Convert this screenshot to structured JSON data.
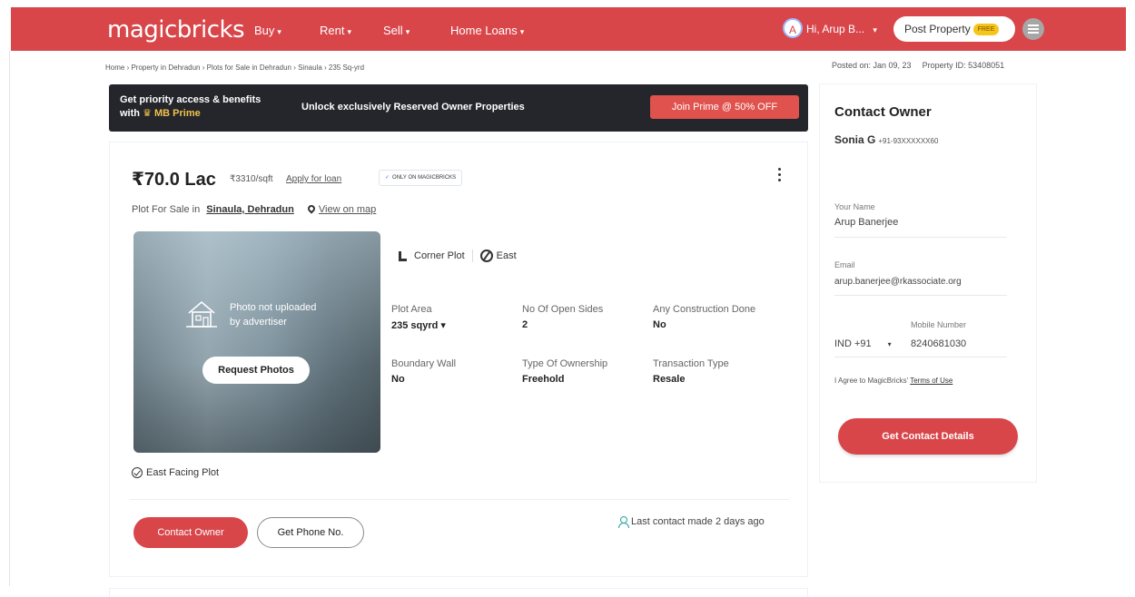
{
  "header": {
    "logo": "magicbricks",
    "nav": [
      {
        "label": "Buy"
      },
      {
        "label": "Rent"
      },
      {
        "label": "Sell"
      },
      {
        "label": "Home Loans"
      }
    ],
    "avatar_letter": "A",
    "greeting": "Hi, Arup B...",
    "post_property": "Post Property",
    "free_badge": "FREE",
    "brand_color": "#d8464a"
  },
  "breadcrumb": "Home › Property in Dehradun › Plots for Sale in Dehradun › Sinaula › 235 Sq-yrd",
  "meta": {
    "posted_on": "Posted on: Jan 09, 23",
    "property_id": "Property ID: 53408051"
  },
  "prime": {
    "line1": "Get priority access & benefits",
    "line2_prefix": "with",
    "line2_brand": "MB Prime",
    "middle": "Unlock exclusively Reserved Owner Properties",
    "button": "Join Prime @ 50% OFF"
  },
  "listing": {
    "price": "₹70.0 Lac",
    "price_per_sqft": "₹3310/sqft",
    "apply_loan": "Apply for loan",
    "only_badge": "ONLY ON MAGICBRICKS",
    "plot_for_sale": "Plot For Sale in",
    "locality": "Sinaula, Dehradun",
    "view_map": "View on map",
    "photo_text_1": "Photo not uploaded",
    "photo_text_2": "by advertiser",
    "request_photos": "Request Photos",
    "chip_corner": "Corner Plot",
    "chip_facing": "East",
    "specs": [
      {
        "label": "Plot Area",
        "value": "235 sqyrd ▾"
      },
      {
        "label": "No Of Open Sides",
        "value": "2"
      },
      {
        "label": "Any Construction Done",
        "value": "No"
      },
      {
        "label": "Boundary Wall",
        "value": "No"
      },
      {
        "label": "Type Of Ownership",
        "value": "Freehold"
      },
      {
        "label": "Transaction Type",
        "value": "Resale"
      }
    ],
    "highlight": "East Facing Plot",
    "contact_owner": "Contact Owner",
    "get_phone": "Get Phone No.",
    "last_contact": "Last contact made 2 days ago"
  },
  "owner_panel": {
    "title": "Contact Owner",
    "owner_name": "Sonia G",
    "owner_phone": "+91-93XXXXXX60",
    "name_label": "Your Name",
    "name_value": "Arup Banerjee",
    "email_label": "Email",
    "email_value": "arup.banerjee@rkassociate.org",
    "mobile_label": "Mobile Number",
    "country_code": "IND +91",
    "mobile_value": "8240681030",
    "agree_prefix": "I Agree to MagicBricks'",
    "terms": "Terms of Use",
    "get_contact": "Get Contact Details"
  }
}
